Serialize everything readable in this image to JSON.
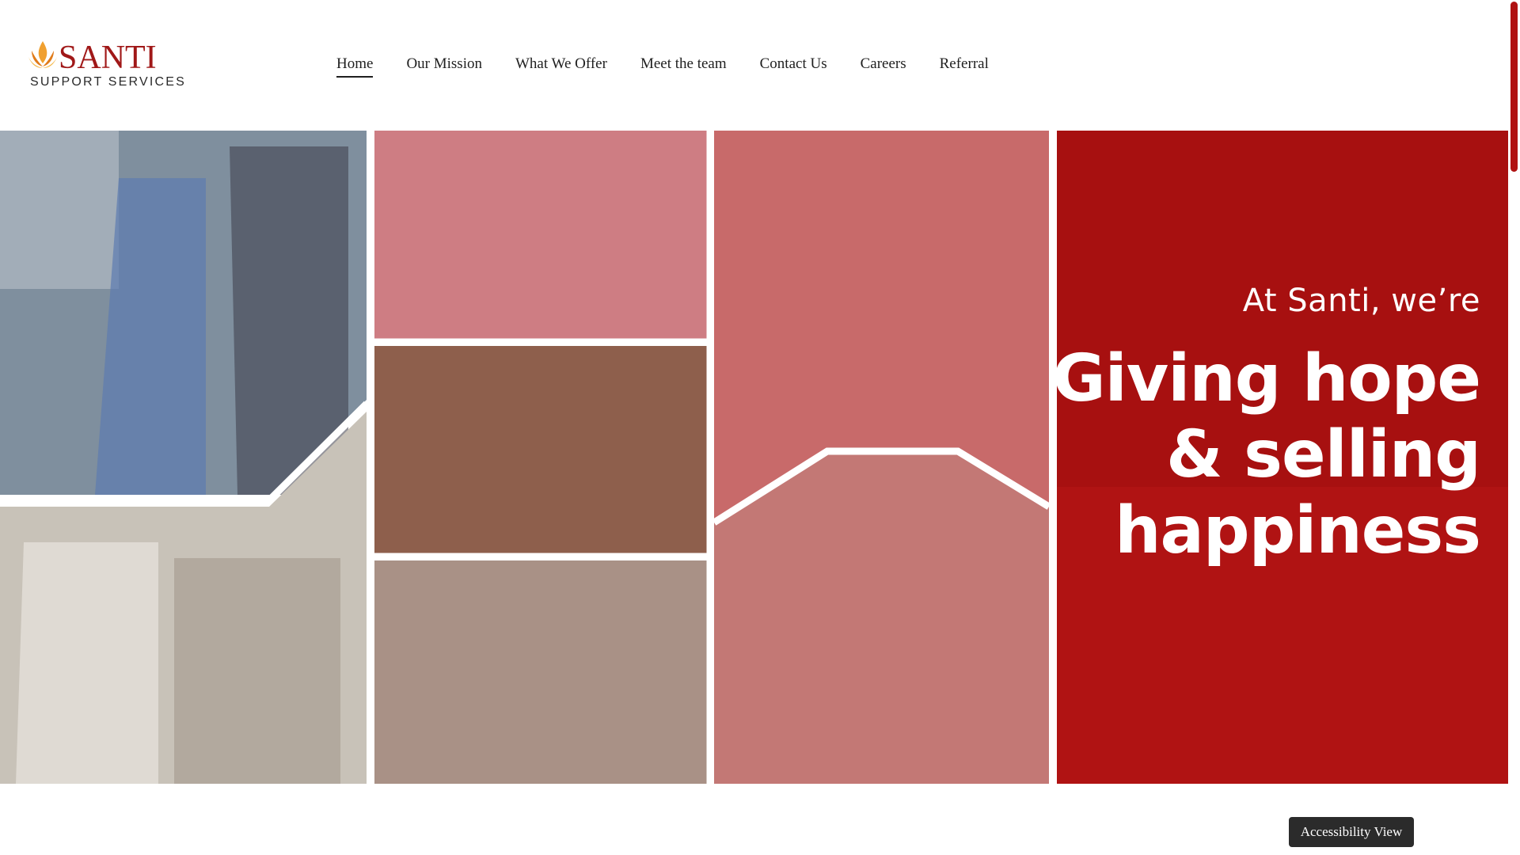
{
  "brand": {
    "name": "SANTI",
    "tagline": "SUPPORT SERVICES",
    "colors": {
      "primary": "#b01212",
      "accent": "#f0a030",
      "text": "#7a1010"
    }
  },
  "nav": {
    "items": [
      {
        "label": "Home",
        "active": true
      },
      {
        "label": "Our Mission",
        "active": false
      },
      {
        "label": "What We Offer",
        "active": false
      },
      {
        "label": "Meet the team",
        "active": false
      },
      {
        "label": "Contact Us",
        "active": false
      },
      {
        "label": "Careers",
        "active": false
      },
      {
        "label": "Referral",
        "active": false
      }
    ]
  },
  "hero": {
    "pretitle": "At Santi, we’re",
    "lines": [
      "Giving hope",
      "& selling",
      "happiness"
    ],
    "overlay_color": "#b01212"
  },
  "accessibility": {
    "label": "Accessibility View"
  }
}
